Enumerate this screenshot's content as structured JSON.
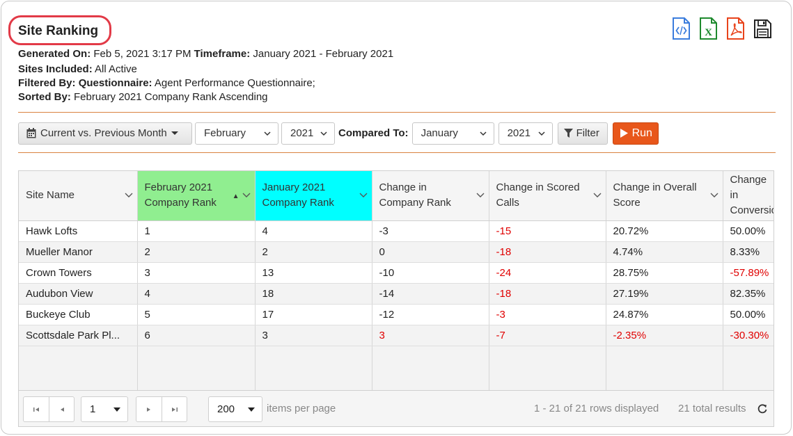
{
  "title": "Site Ranking",
  "meta": {
    "generated_label": "Generated On:",
    "generated_value": "Feb 5, 2021 3:17 PM",
    "timeframe_label": "Timeframe:",
    "timeframe_value": "January 2021 - February 2021",
    "sites_label": "Sites Included:",
    "sites_value": "All Active",
    "filtered_label": "Filtered By:",
    "questionnaire_label": "Questionnaire:",
    "questionnaire_value": "Agent Performance Questionnaire;",
    "sorted_label": "Sorted By:",
    "sorted_value": "February 2021 Company Rank Ascending"
  },
  "toolbar": {
    "period_label": "Current vs. Previous Month",
    "month1": "February",
    "year1": "2021",
    "compared_label": "Compared To:",
    "month2": "January",
    "year2": "2021",
    "filter_label": "Filter",
    "run_label": "Run"
  },
  "columns": [
    "Site Name",
    "February 2021 Company Rank",
    "January 2021 Company Rank",
    "Change in Company Rank",
    "Change in Scored Calls",
    "Change in Overall Score",
    "Change in Conversion"
  ],
  "rows": [
    [
      "Hawk Lofts",
      "1",
      "4",
      "-3",
      "-15",
      "20.72%",
      "50.00%"
    ],
    [
      "Mueller Manor",
      "2",
      "2",
      "0",
      "-18",
      "4.74%",
      "8.33%"
    ],
    [
      "Crown Towers",
      "3",
      "13",
      "-10",
      "-24",
      "28.75%",
      "-57.89%"
    ],
    [
      "Audubon View",
      "4",
      "18",
      "-14",
      "-18",
      "27.19%",
      "82.35%"
    ],
    [
      "Buckeye Club",
      "5",
      "17",
      "-12",
      "-3",
      "24.87%",
      "50.00%"
    ],
    [
      "Scottsdale Park Pl...",
      "6",
      "3",
      "3",
      "-7",
      "-2.35%",
      "-30.30%"
    ]
  ],
  "negative_cells": [
    [
      false,
      false,
      false,
      false,
      true,
      false,
      false
    ],
    [
      false,
      false,
      false,
      false,
      true,
      false,
      false
    ],
    [
      false,
      false,
      false,
      false,
      true,
      false,
      true
    ],
    [
      false,
      false,
      false,
      false,
      true,
      false,
      false
    ],
    [
      false,
      false,
      false,
      false,
      true,
      false,
      false
    ],
    [
      false,
      false,
      false,
      true,
      true,
      true,
      true
    ]
  ],
  "pager": {
    "page": "1",
    "per_page": "200",
    "per_page_label": "items per page",
    "rows_displayed": "1 - 21 of 21 rows displayed",
    "total_results": "21 total results"
  },
  "colors": {
    "accent_orange": "#e8571b",
    "feb_header": "#90ee90",
    "jan_header": "#00ffff",
    "negative": "#e00000",
    "title_ring": "#e23a47"
  },
  "icons": [
    "html-export-icon",
    "excel-export-icon",
    "pdf-export-icon",
    "save-icon",
    "calendar-icon",
    "filter-icon",
    "play-icon",
    "refresh-icon"
  ]
}
